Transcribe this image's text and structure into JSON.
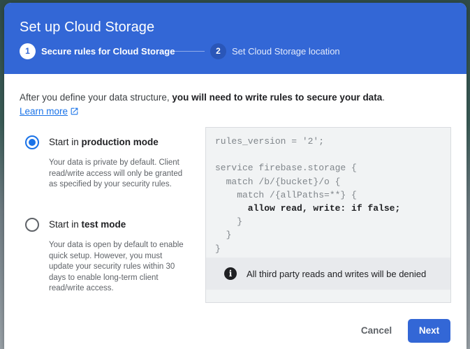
{
  "dialog": {
    "title": "Set up Cloud Storage",
    "steps": [
      {
        "number": "1",
        "label": "Secure rules for Cloud Storage",
        "state": "active"
      },
      {
        "number": "2",
        "label": "Set Cloud Storage location",
        "state": "inactive"
      }
    ],
    "intro_plain": "After you define your data structure, ",
    "intro_bold": "you will need to write rules to secure your data",
    "intro_end": ".",
    "learn_more": "Learn more",
    "options": [
      {
        "label_prefix": "Start in ",
        "label_bold": "production mode",
        "checked": true,
        "description": "Your data is private by default. Client read/write access will only be granted as specified by your security rules."
      },
      {
        "label_prefix": "Start in ",
        "label_bold": "test mode",
        "checked": false,
        "description": "Your data is open by default to enable quick setup. However, you must update your security rules within 30 days to enable long-term client read/write access."
      }
    ],
    "code_lines": [
      "rules_version = '2';",
      "",
      "service firebase.storage {",
      "  match /b/{bucket}/o {",
      "    match /{allPaths=**} {",
      "      allow read, write: if false;",
      "    }",
      "  }",
      "}"
    ],
    "notice": "All third party reads and writes will be denied",
    "cancel_label": "Cancel",
    "next_label": "Next",
    "colors": {
      "header": "#3367d6",
      "accent": "#1a73e8"
    },
    "icons": {
      "info": "info-icon",
      "external_link": "external-link-icon"
    }
  }
}
